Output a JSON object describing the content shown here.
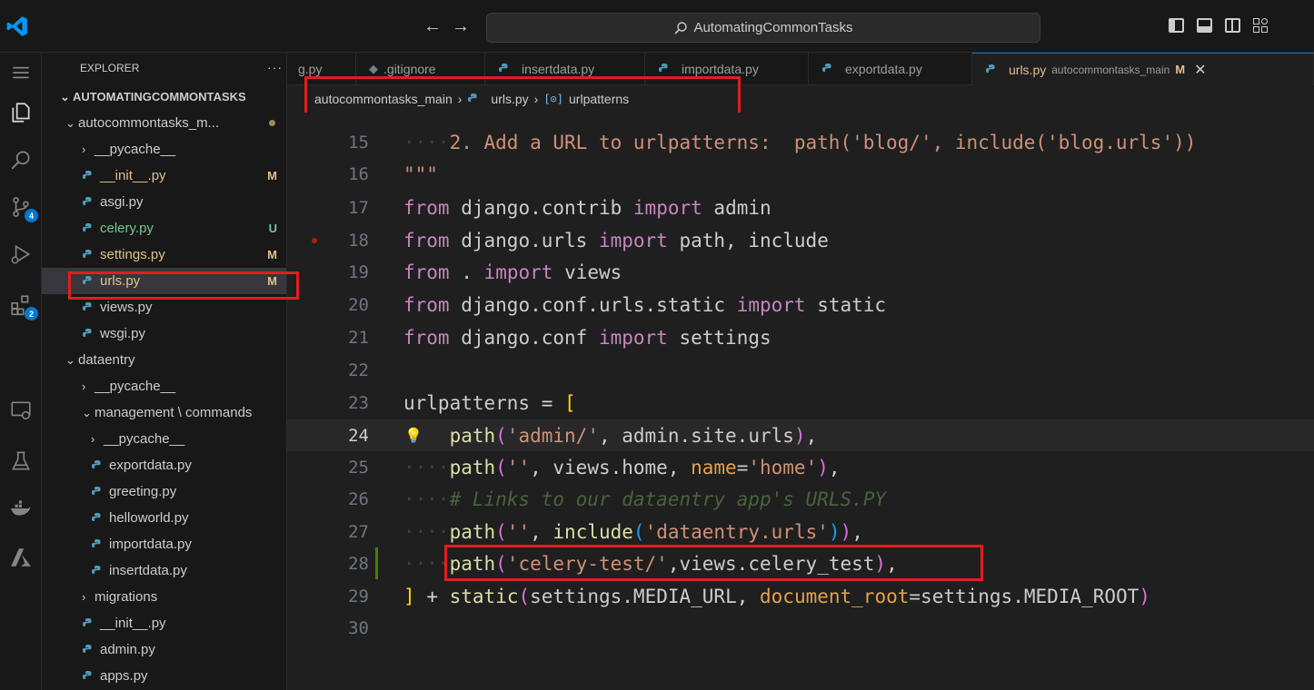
{
  "titlebar": {
    "search_text": "AutomatingCommonTasks"
  },
  "activity": {
    "source_control_badge": "4",
    "extensions_badge": "2"
  },
  "explorer": {
    "title": "EXPLORER",
    "more": "···",
    "root": "AUTOMATINGCOMMONTASKS",
    "items": [
      {
        "label": "autocommontasks_m...",
        "kind": "folder-open",
        "depth": 1,
        "status": "dot"
      },
      {
        "label": "__pycache__",
        "kind": "folder",
        "depth": 2,
        "status": ""
      },
      {
        "label": "__init__.py",
        "kind": "py",
        "depth": 2,
        "status": "M"
      },
      {
        "label": "asgi.py",
        "kind": "py",
        "depth": 2,
        "status": ""
      },
      {
        "label": "celery.py",
        "kind": "py",
        "depth": 2,
        "status": "U"
      },
      {
        "label": "settings.py",
        "kind": "py",
        "depth": 2,
        "status": "M"
      },
      {
        "label": "urls.py",
        "kind": "py",
        "depth": 2,
        "status": "M",
        "selected": true
      },
      {
        "label": "views.py",
        "kind": "py",
        "depth": 2,
        "status": ""
      },
      {
        "label": "wsgi.py",
        "kind": "py",
        "depth": 2,
        "status": ""
      },
      {
        "label": "dataentry",
        "kind": "folder-open",
        "depth": 1,
        "status": ""
      },
      {
        "label": "__pycache__",
        "kind": "folder",
        "depth": 2,
        "status": ""
      },
      {
        "label": "management \\ commands",
        "kind": "folder-open",
        "depth": 2,
        "status": ""
      },
      {
        "label": "__pycache__",
        "kind": "folder",
        "depth": 3,
        "status": ""
      },
      {
        "label": "exportdata.py",
        "kind": "py",
        "depth": 3,
        "status": ""
      },
      {
        "label": "greeting.py",
        "kind": "py",
        "depth": 3,
        "status": ""
      },
      {
        "label": "helloworld.py",
        "kind": "py",
        "depth": 3,
        "status": ""
      },
      {
        "label": "importdata.py",
        "kind": "py",
        "depth": 3,
        "status": ""
      },
      {
        "label": "insertdata.py",
        "kind": "py",
        "depth": 3,
        "status": ""
      },
      {
        "label": "migrations",
        "kind": "folder",
        "depth": 2,
        "status": ""
      },
      {
        "label": "__init__.py",
        "kind": "py",
        "depth": 2,
        "status": ""
      },
      {
        "label": "admin.py",
        "kind": "py",
        "depth": 2,
        "status": ""
      },
      {
        "label": "apps.py",
        "kind": "py",
        "depth": 2,
        "status": ""
      }
    ]
  },
  "tabs": [
    {
      "label": "g.py",
      "icon": ""
    },
    {
      "label": ".gitignore",
      "icon": "gitignore"
    },
    {
      "label": "insertdata.py",
      "icon": "py"
    },
    {
      "label": "importdata.py",
      "icon": "py"
    },
    {
      "label": "exportdata.py",
      "icon": "py"
    },
    {
      "label": "urls.py",
      "icon": "py",
      "desc": "autocommontasks_main",
      "mod": "M",
      "active": true
    }
  ],
  "breadcrumb": {
    "folder": "autocommontasks_main",
    "file": "urls.py",
    "symbol": "urlpatterns"
  },
  "editor": {
    "line_numbers": [
      "15",
      "16",
      "17",
      "18",
      "19",
      "20",
      "21",
      "22",
      "23",
      "24",
      "25",
      "26",
      "27",
      "28",
      "29",
      "30"
    ],
    "lines": {
      "l15": "2. Add a URL to urlpatterns:  path('blog/', include('blog.urls'))",
      "l16": "\"\"\"",
      "l17_kw1": "from",
      "l17_mod": "django.contrib",
      "l17_kw2": "import",
      "l17_name": "admin",
      "l18_kw1": "from",
      "l18_mod": "django.urls",
      "l18_kw2": "import",
      "l18_name": "path, include",
      "l19_kw1": "from",
      "l19_mod": ".",
      "l19_kw2": "import",
      "l19_name": "views",
      "l20_kw1": "from",
      "l20_mod": "django.conf.urls.static",
      "l20_kw2": "import",
      "l20_name": "static",
      "l21_kw1": "from",
      "l21_mod": "django.conf",
      "l21_kw2": "import",
      "l21_name": "settings",
      "l23_var": "urlpatterns",
      "l23_eq": "=",
      "l23_br": "[",
      "l24_fn": "path",
      "l24_str": "'admin/'",
      "l24_rest": ", admin.site.urls",
      "l25_fn": "path",
      "l25_str": "''",
      "l25_rest": ", views.home, ",
      "l25_param": "name",
      "l25_str2": "'home'",
      "l26_cmt": "# Links to our dataentry app's URLS.PY",
      "l27_fn": "path",
      "l27_str": "''",
      "l27_fn2": "include",
      "l27_str2": "'dataentry.urls'",
      "l28_fn": "path",
      "l28_str": "'celery-test/'",
      "l28_rest": ",views.celery_test",
      "l29_br": "]",
      "l29_plus": "+",
      "l29_fn": "static",
      "l29_a": "settings.MEDIA_URL, ",
      "l29_param": "document_root",
      "l29_b": "settings.MEDIA_ROOT"
    }
  },
  "colors": {
    "accent": "#0078d4",
    "highlight_box": "#e11d21",
    "modified": "#e2c08d",
    "untracked": "#73c991"
  }
}
